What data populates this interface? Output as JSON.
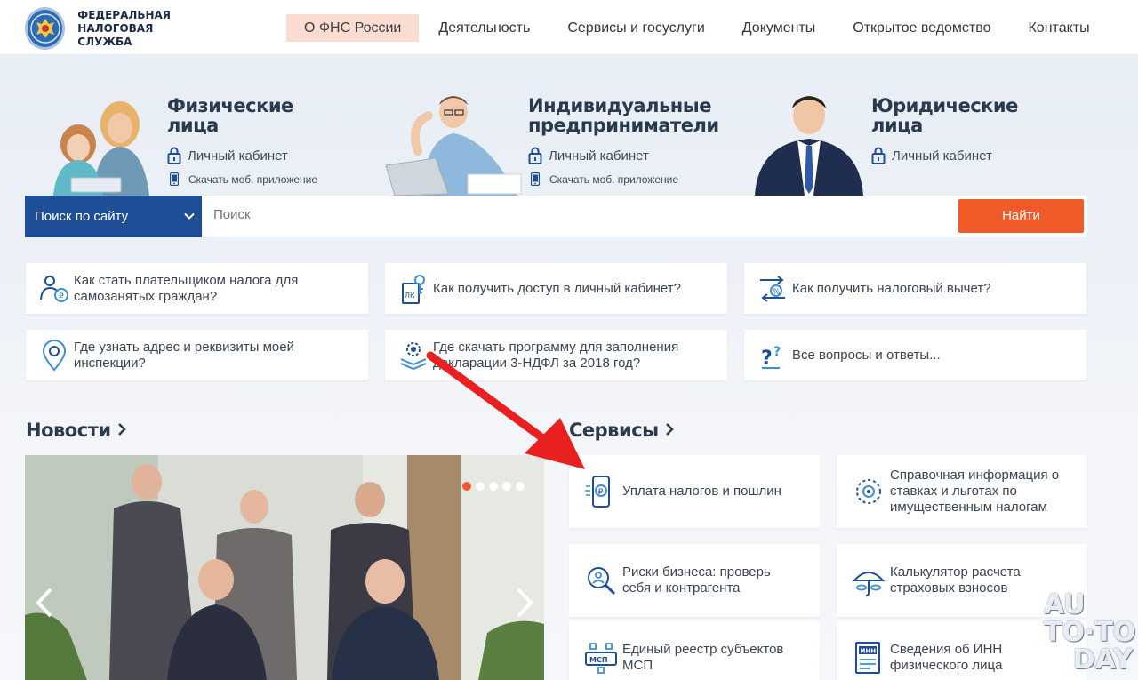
{
  "header": {
    "logo_line1": "ФЕДЕРАЛЬНАЯ",
    "logo_line2": "НАЛОГОВАЯ СЛУЖБА",
    "nav": [
      {
        "label": "О ФНС России",
        "active": true
      },
      {
        "label": "Деятельность"
      },
      {
        "label": "Сервисы и госуслуги"
      },
      {
        "label": "Документы"
      },
      {
        "label": "Открытое ведомство"
      },
      {
        "label": "Контакты"
      }
    ]
  },
  "groups": [
    {
      "title_line1": "Физические",
      "title_line2": "лица",
      "cabinet": "Личный кабинет",
      "app": "Скачать моб. приложение"
    },
    {
      "title_line1": "Индивидуальные",
      "title_line2": "предприниматели",
      "cabinet": "Личный кабинет",
      "app": "Скачать моб. приложение"
    },
    {
      "title_line1": "Юридические",
      "title_line2": "лица",
      "cabinet": "Личный кабинет"
    }
  ],
  "search": {
    "scope": "Поиск по сайту",
    "placeholder": "Поиск",
    "button": "Найти"
  },
  "faq": [
    {
      "line1": "Как стать плательщиком налога для",
      "line2": "самозанятых граждан?",
      "icon": "self-employed-icon"
    },
    {
      "line1": "Как получить доступ в личный кабинет?",
      "line2": "",
      "icon": "personal-account-icon"
    },
    {
      "line1": "Как получить налоговый вычет?",
      "line2": "",
      "icon": "tax-deduction-icon"
    },
    {
      "line1": "Где узнать адрес и реквизиты моей",
      "line2": "инспекции?",
      "icon": "location-icon"
    },
    {
      "line1": "Где скачать программу для заполнения",
      "line2": "декларации 3-НДФЛ за 2018 год?",
      "icon": "software-download-icon"
    },
    {
      "line1": "Все вопросы и ответы...",
      "line2": "",
      "icon": "questions-icon"
    }
  ],
  "news": {
    "title": "Новости",
    "slides": 5,
    "active_slide": 1
  },
  "services": {
    "title": "Сервисы",
    "items": [
      {
        "line1": "Уплата налогов и пошлин",
        "line2": "",
        "line3": "",
        "icon": "payment-phone-icon"
      },
      {
        "line1": "Справочная информация о",
        "line2": "ставках и льготах по",
        "line3": "имущественным налогам",
        "icon": "reference-info-icon"
      },
      {
        "line1": "Риски бизнеса: проверь",
        "line2": "себя и контрагента",
        "line3": "",
        "icon": "business-risk-icon"
      },
      {
        "line1": "Калькулятор расчета",
        "line2": "страховых взносов",
        "line3": "",
        "icon": "calculator-icon"
      },
      {
        "line1": "Единый реестр субъектов",
        "line2": "МСП",
        "line3": "",
        "icon": "msp-registry-icon"
      },
      {
        "line1": "Сведения об ИНН",
        "line2": "физического лица",
        "line3": "",
        "icon": "inn-document-icon"
      }
    ]
  },
  "watermark": {
    "line1": "AU",
    "line2": "TO·TO",
    "line3": "DAY"
  },
  "colors": {
    "brand_blue": "#1d4e96",
    "accent_orange": "#f05a28",
    "nav_active_bg": "#fbdcd0",
    "annotation_red": "#e8201f"
  }
}
